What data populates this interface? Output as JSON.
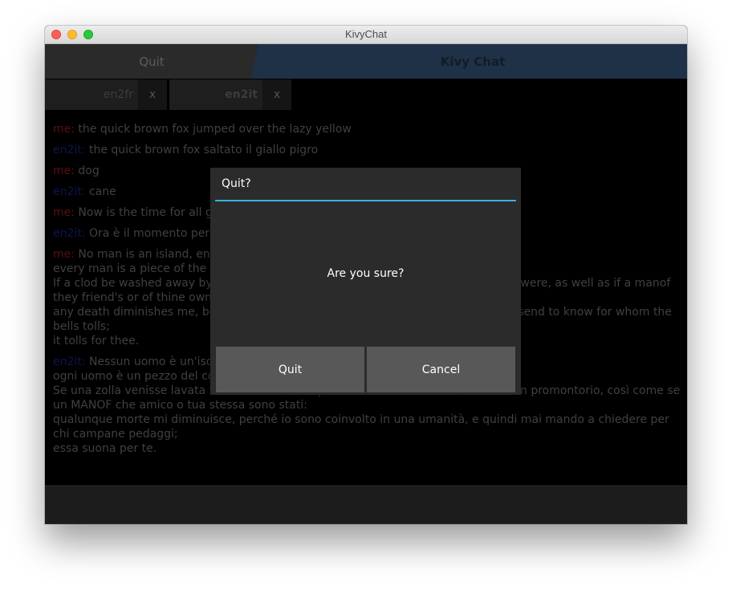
{
  "window": {
    "title": "KivyChat"
  },
  "topbar": {
    "quit_label": "Quit",
    "title": "Kivy Chat"
  },
  "lang_tabs": [
    {
      "label": "en2fr",
      "close": "x"
    },
    {
      "label": "en2it",
      "close": "x"
    }
  ],
  "messages": [
    {
      "who": "me:",
      "text": "the quick brown fox jumped over the lazy yellow"
    },
    {
      "who": "en2it:",
      "text": "the quick brown fox saltato il giallo pigro"
    },
    {
      "who": "me:",
      "text": "dog"
    },
    {
      "who": "en2it:",
      "text": "cane"
    },
    {
      "who": "me:",
      "text": "Now is the time for all good men to come to the aid of the party"
    },
    {
      "who": "en2it:",
      "text": "Ora è il momento per tutti gli uomini buoni di venire in aiuto del partito"
    },
    {
      "who": "me:",
      "text": "No man is an island, entire of itself;\nevery man is a piece of the continent, a part of the main.\nIf a clod be washed away by the sea, Europe is the less, as well as if a promontory were, as well as if a manof they friend's or of thine own were:\nany death diminishes me, because I am involved in mankind, and therefore never send to know for whom the bells tolls;\nit tolls for thee."
    },
    {
      "who": "en2it:",
      "text": "Nessun uomo è un'isola, intero in se stesso;\nogni uomo è un pezzo del continente, una parte del tutto.\nSe una zolla venisse lavata via dal mare, l'Europa ne sarebbe diminuita, come se un promontorio, così come se un MANOF che amico o tua stessa sono stati:\nqualunque morte mi diminuisce, perché io sono coinvolto in una umanità, e quindi mai mando a chiedere per chi campane pedaggi;\nessa suona per te."
    }
  ],
  "dialog": {
    "title": "Quit?",
    "message": "Are you sure?",
    "quit_label": "Quit",
    "cancel_label": "Cancel"
  },
  "colors": {
    "accent_line": "#33b5e5",
    "title_tab": "#1f3147",
    "me_label": "#5a1010",
    "bot_label": "#0e1550"
  }
}
